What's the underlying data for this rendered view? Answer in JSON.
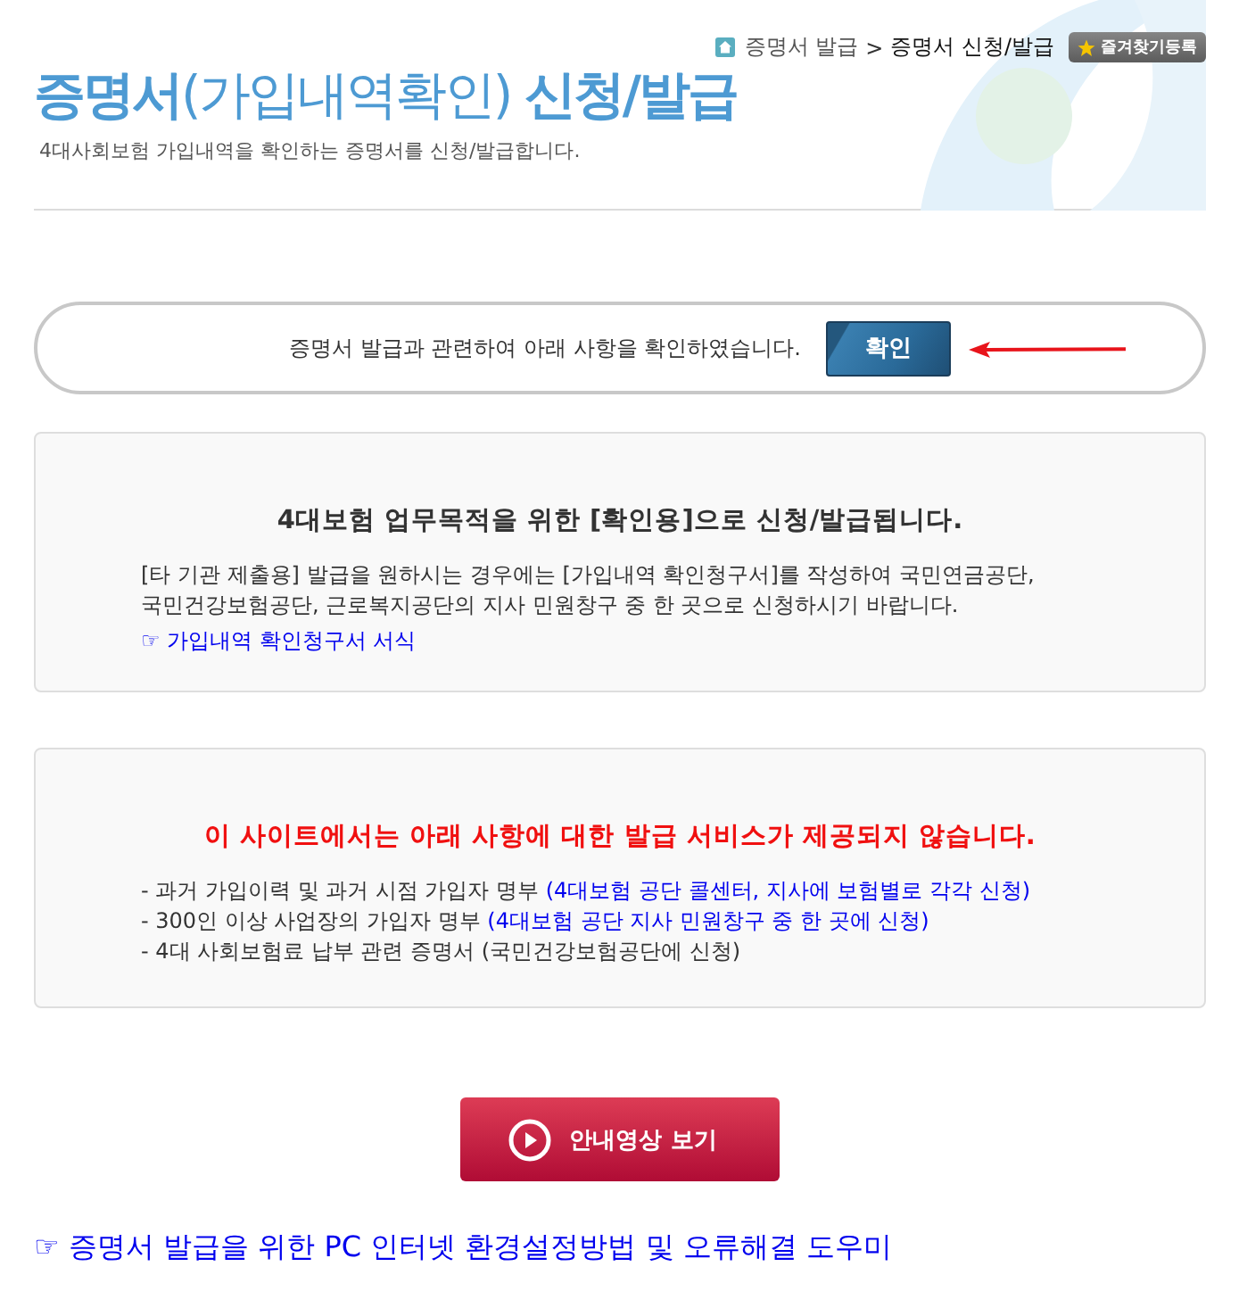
{
  "breadcrumb": {
    "items": [
      {
        "label": "증명서 발급",
        "current": false
      },
      {
        "label": "증명서 신청/발급",
        "current": true
      }
    ],
    "separator": ">"
  },
  "favorite_button": {
    "label": "즐겨찾기등록"
  },
  "page_title": "**증명서**(가입내역확인) **신청/발급**",
  "subtitle": "4대사회보험 가입내역을 확인하는 증명서를 신청/발급합니다.",
  "confirm": {
    "text": "증명서 발급과 관련하여 아래 사항을 확인하였습니다.",
    "button": "확인"
  },
  "notice_box": {
    "heading": "4대보험 업무목적을 위한 [확인용]으로 신청/발급됩니다.",
    "paragraph": [
      "[타 기관 제출용] 발급을 원하시는 경우에는 [가입내역 확인청구서]를 작성하여 국민연금공단,",
      "국민건강보험공단, 근로복지공단의 지사 민원창구 중 한 곳으로 신청하시기 바랍니다."
    ],
    "link": "☞ 가입내역 확인청구서 서식"
  },
  "restriction_box": {
    "heading": "이 사이트에서는 아래 사항에 대한 발급 서비스가 제공되지 않습니다.",
    "items": [
      {
        "text": "- 과거 가입이력 및 과거 시점 가입자 명부",
        "note": "(4대보험 공단 콜센터, 지사에 보험별로 각각 신청)"
      },
      {
        "text": "- 300인 이상 사업장의 가입자 명부",
        "note": "(4대보험 공단 지사 민원창구 중 한 곳에 신청)"
      },
      {
        "text": "- 4대 사회보험료 납부 관련 증명서 (국민건강보험공단에 신청)"
      }
    ]
  },
  "video_button": {
    "label": "안내영상 보기"
  },
  "help_link": "☞ 증명서 발급을 위한 PC 인터넷 환경설정방법 및 오류해결 도우미"
}
